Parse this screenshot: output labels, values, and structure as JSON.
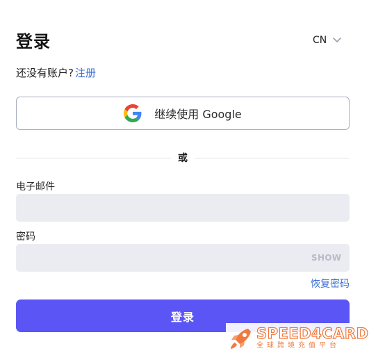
{
  "header": {
    "title": "登录",
    "language": "CN"
  },
  "signup": {
    "prompt": "还没有账户?",
    "link_label": "注册"
  },
  "google_button": {
    "label": "继续使用 Google"
  },
  "divider": {
    "label": "或"
  },
  "form": {
    "email_label": "电子邮件",
    "email_value": "",
    "password_label": "密码",
    "password_value": "",
    "show_label": "SHOW",
    "forgot_label": "恢复密码",
    "submit_label": "登录"
  },
  "watermark": {
    "brand": "SPEED4CARD",
    "tagline": "全球跨境充值平台"
  },
  "colors": {
    "primary_button": "#5b55f5",
    "link": "#3b6fd4",
    "input_bg": "#ebecf1",
    "watermark_accent": "#f0783c"
  },
  "icons": {
    "google": "google-g-icon",
    "language_chevron": "chevron-down-icon",
    "watermark_logo": "rocket-icon"
  }
}
